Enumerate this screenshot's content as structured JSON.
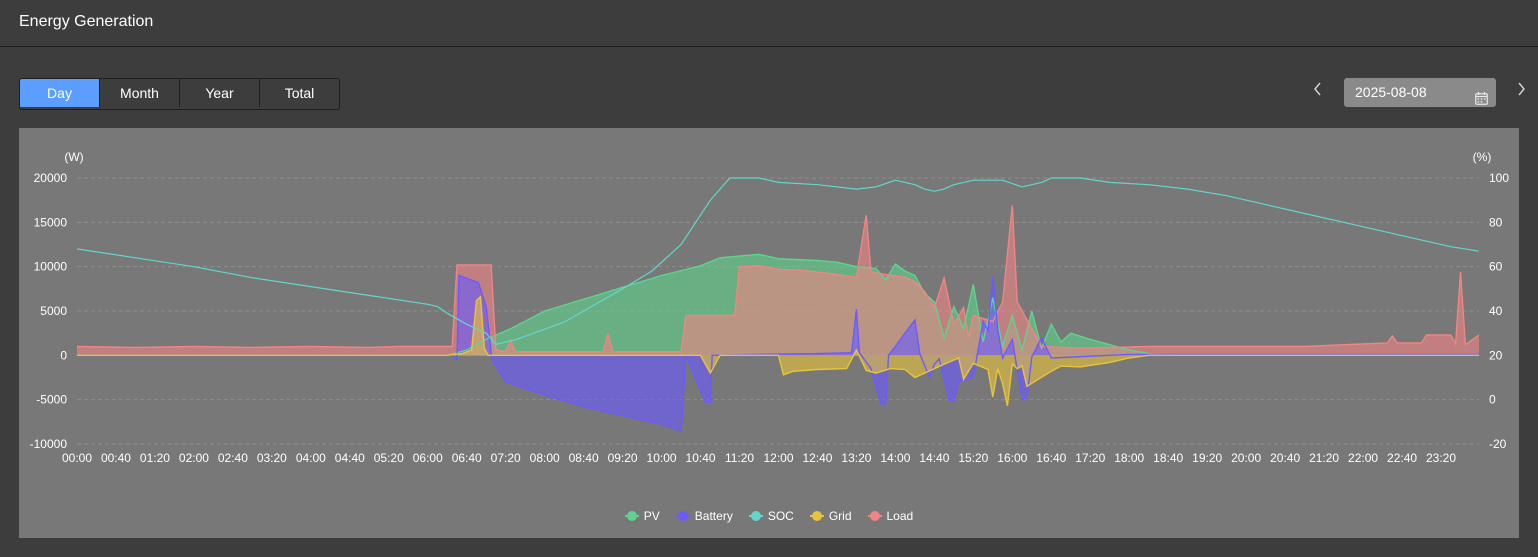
{
  "header": {
    "title": "Energy Generation"
  },
  "tabs": [
    {
      "label": "Day",
      "active": true
    },
    {
      "label": "Month",
      "active": false
    },
    {
      "label": "Year",
      "active": false
    },
    {
      "label": "Total",
      "active": false
    }
  ],
  "date_picker": {
    "value": "2025-08-08",
    "prev_icon": "chevron-left-icon",
    "next_icon": "chevron-right-icon",
    "calendar_icon": "calendar-icon"
  },
  "chart_data": {
    "type": "area",
    "x_ticks": [
      "00:00",
      "00:40",
      "01:20",
      "02:00",
      "02:40",
      "03:20",
      "04:00",
      "04:40",
      "05:20",
      "06:00",
      "06:40",
      "07:20",
      "08:00",
      "08:40",
      "09:20",
      "10:00",
      "10:40",
      "11:20",
      "12:00",
      "12:40",
      "13:20",
      "14:00",
      "14:40",
      "15:20",
      "16:00",
      "16:40",
      "17:20",
      "18:00",
      "18:40",
      "19:20",
      "20:00",
      "20:40",
      "21:20",
      "22:00",
      "22:40",
      "23:20"
    ],
    "y_left": {
      "label": "(W)",
      "ticks": [
        20000,
        15000,
        10000,
        5000,
        0,
        -5000,
        -10000
      ],
      "range": [
        -10000,
        20000
      ]
    },
    "y_right": {
      "label": "(%)",
      "ticks": [
        100,
        80,
        60,
        40,
        20,
        0,
        -20
      ],
      "range": [
        -20,
        100
      ]
    },
    "grid": true,
    "legend_position": "bottom",
    "series": [
      {
        "name": "PV",
        "color": "#5fd38d",
        "axis": "left",
        "points": [
          [
            0,
            0
          ],
          [
            380,
            0
          ],
          [
            400,
            600
          ],
          [
            420,
            1800
          ],
          [
            445,
            3000
          ],
          [
            480,
            5000
          ],
          [
            540,
            7000
          ],
          [
            600,
            9000
          ],
          [
            640,
            10100
          ],
          [
            660,
            11000
          ],
          [
            700,
            11400
          ],
          [
            720,
            10900
          ],
          [
            760,
            10700
          ],
          [
            780,
            10500
          ],
          [
            800,
            10000
          ],
          [
            820,
            9800
          ],
          [
            830,
            8500
          ],
          [
            840,
            10300
          ],
          [
            850,
            9500
          ],
          [
            860,
            9000
          ],
          [
            870,
            7000
          ],
          [
            880,
            6000
          ],
          [
            890,
            2000
          ],
          [
            900,
            5500
          ],
          [
            910,
            3000
          ],
          [
            920,
            8000
          ],
          [
            930,
            1500
          ],
          [
            940,
            6500
          ],
          [
            950,
            1000
          ],
          [
            960,
            4500
          ],
          [
            970,
            600
          ],
          [
            980,
            5000
          ],
          [
            990,
            800
          ],
          [
            1000,
            3500
          ],
          [
            1010,
            1500
          ],
          [
            1020,
            2500
          ],
          [
            1040,
            1800
          ],
          [
            1060,
            1200
          ],
          [
            1080,
            600
          ],
          [
            1100,
            200
          ],
          [
            1140,
            0
          ],
          [
            1439,
            0
          ]
        ]
      },
      {
        "name": "Battery",
        "color": "#6b5bff",
        "axis": "left",
        "points": [
          [
            0,
            0
          ],
          [
            385,
            0
          ],
          [
            390,
            -500
          ],
          [
            392,
            9000
          ],
          [
            412,
            8200
          ],
          [
            420,
            5500
          ],
          [
            426,
            -500
          ],
          [
            440,
            -3000
          ],
          [
            480,
            -4500
          ],
          [
            520,
            -5800
          ],
          [
            560,
            -6800
          ],
          [
            600,
            -7800
          ],
          [
            620,
            -8500
          ],
          [
            625,
            0
          ],
          [
            645,
            -5300
          ],
          [
            650,
            -5300
          ],
          [
            652,
            0
          ],
          [
            700,
            100
          ],
          [
            760,
            200
          ],
          [
            795,
            300
          ],
          [
            800,
            5200
          ],
          [
            803,
            300
          ],
          [
            815,
            -1500
          ],
          [
            825,
            -5500
          ],
          [
            830,
            -5500
          ],
          [
            833,
            0
          ],
          [
            860,
            4000
          ],
          [
            865,
            200
          ],
          [
            875,
            -2500
          ],
          [
            880,
            -1000
          ],
          [
            885,
            -400
          ],
          [
            895,
            -5000
          ],
          [
            900,
            -5200
          ],
          [
            905,
            -3000
          ],
          [
            920,
            -2500
          ],
          [
            930,
            3800
          ],
          [
            935,
            2800
          ],
          [
            940,
            9000
          ],
          [
            945,
            3000
          ],
          [
            950,
            -300
          ],
          [
            960,
            1800
          ],
          [
            970,
            -5000
          ],
          [
            975,
            -4800
          ],
          [
            980,
            -200
          ],
          [
            990,
            2000
          ],
          [
            1000,
            -300
          ],
          [
            1080,
            100
          ],
          [
            1439,
            100
          ]
        ]
      },
      {
        "name": "SOC",
        "color": "#62d6cc",
        "axis": "right",
        "points": [
          [
            0,
            68
          ],
          [
            60,
            64
          ],
          [
            120,
            60
          ],
          [
            180,
            55
          ],
          [
            240,
            51
          ],
          [
            300,
            47
          ],
          [
            360,
            43
          ],
          [
            370,
            42
          ],
          [
            380,
            39
          ],
          [
            400,
            34
          ],
          [
            420,
            30
          ],
          [
            430,
            25
          ],
          [
            450,
            27
          ],
          [
            500,
            35
          ],
          [
            560,
            50
          ],
          [
            590,
            58
          ],
          [
            620,
            70
          ],
          [
            650,
            90
          ],
          [
            670,
            100
          ],
          [
            700,
            100
          ],
          [
            720,
            98
          ],
          [
            760,
            97
          ],
          [
            800,
            95
          ],
          [
            820,
            96
          ],
          [
            840,
            99
          ],
          [
            860,
            97
          ],
          [
            870,
            95
          ],
          [
            880,
            94
          ],
          [
            890,
            95
          ],
          [
            900,
            97
          ],
          [
            920,
            99
          ],
          [
            950,
            99
          ],
          [
            970,
            96
          ],
          [
            990,
            98
          ],
          [
            1000,
            100
          ],
          [
            1030,
            100
          ],
          [
            1060,
            98
          ],
          [
            1100,
            97
          ],
          [
            1140,
            95
          ],
          [
            1180,
            92
          ],
          [
            1220,
            88
          ],
          [
            1260,
            84
          ],
          [
            1300,
            80
          ],
          [
            1340,
            76
          ],
          [
            1380,
            72
          ],
          [
            1410,
            69
          ],
          [
            1439,
            67
          ]
        ]
      },
      {
        "name": "Grid",
        "color": "#e8c43a",
        "axis": "left",
        "points": [
          [
            0,
            0
          ],
          [
            380,
            0
          ],
          [
            395,
            200
          ],
          [
            405,
            600
          ],
          [
            410,
            6200
          ],
          [
            414,
            6600
          ],
          [
            418,
            800
          ],
          [
            422,
            0
          ],
          [
            640,
            0
          ],
          [
            650,
            -2000
          ],
          [
            660,
            0
          ],
          [
            720,
            0
          ],
          [
            725,
            -2200
          ],
          [
            735,
            -1800
          ],
          [
            760,
            -1600
          ],
          [
            790,
            -1500
          ],
          [
            800,
            600
          ],
          [
            810,
            -1700
          ],
          [
            820,
            -2000
          ],
          [
            835,
            -1500
          ],
          [
            850,
            -1600
          ],
          [
            860,
            -2500
          ],
          [
            870,
            -2000
          ],
          [
            890,
            -1000
          ],
          [
            905,
            -300
          ],
          [
            910,
            -2700
          ],
          [
            920,
            -900
          ],
          [
            935,
            -1600
          ],
          [
            940,
            -4700
          ],
          [
            945,
            -1500
          ],
          [
            950,
            -3200
          ],
          [
            955,
            -5700
          ],
          [
            960,
            -1000
          ],
          [
            965,
            -1500
          ],
          [
            970,
            -1200
          ],
          [
            975,
            -3500
          ],
          [
            985,
            -2800
          ],
          [
            1000,
            -1800
          ],
          [
            1010,
            -1200
          ],
          [
            1030,
            -1300
          ],
          [
            1060,
            -800
          ],
          [
            1080,
            -300
          ],
          [
            1100,
            0
          ],
          [
            1439,
            0
          ]
        ]
      },
      {
        "name": "Load",
        "color": "#ef8585",
        "axis": "left",
        "points": [
          [
            0,
            1000
          ],
          [
            60,
            900
          ],
          [
            120,
            1000
          ],
          [
            180,
            900
          ],
          [
            240,
            1000
          ],
          [
            300,
            900
          ],
          [
            330,
            1000
          ],
          [
            385,
            1000
          ],
          [
            390,
            10200
          ],
          [
            425,
            10200
          ],
          [
            430,
            600
          ],
          [
            440,
            400
          ],
          [
            445,
            1700
          ],
          [
            450,
            400
          ],
          [
            540,
            400
          ],
          [
            545,
            2400
          ],
          [
            550,
            400
          ],
          [
            620,
            400
          ],
          [
            625,
            4500
          ],
          [
            675,
            4500
          ],
          [
            680,
            10000
          ],
          [
            700,
            10100
          ],
          [
            720,
            9700
          ],
          [
            740,
            9600
          ],
          [
            760,
            9400
          ],
          [
            780,
            9100
          ],
          [
            800,
            8800
          ],
          [
            810,
            15800
          ],
          [
            815,
            9400
          ],
          [
            830,
            9100
          ],
          [
            850,
            8800
          ],
          [
            860,
            8300
          ],
          [
            870,
            7200
          ],
          [
            880,
            5400
          ],
          [
            890,
            8700
          ],
          [
            900,
            3500
          ],
          [
            910,
            5400
          ],
          [
            915,
            2000
          ],
          [
            920,
            4500
          ],
          [
            940,
            3800
          ],
          [
            950,
            6000
          ],
          [
            960,
            16900
          ],
          [
            965,
            6000
          ],
          [
            970,
            5000
          ],
          [
            985,
            2000
          ],
          [
            990,
            1000
          ],
          [
            1030,
            800
          ],
          [
            1100,
            1000
          ],
          [
            1200,
            1000
          ],
          [
            1260,
            1000
          ],
          [
            1300,
            1200
          ],
          [
            1345,
            1400
          ],
          [
            1350,
            2200
          ],
          [
            1355,
            1400
          ],
          [
            1380,
            1400
          ],
          [
            1385,
            2300
          ],
          [
            1410,
            2300
          ],
          [
            1415,
            1300
          ],
          [
            1420,
            9400
          ],
          [
            1425,
            1200
          ],
          [
            1439,
            2300
          ]
        ]
      }
    ]
  }
}
